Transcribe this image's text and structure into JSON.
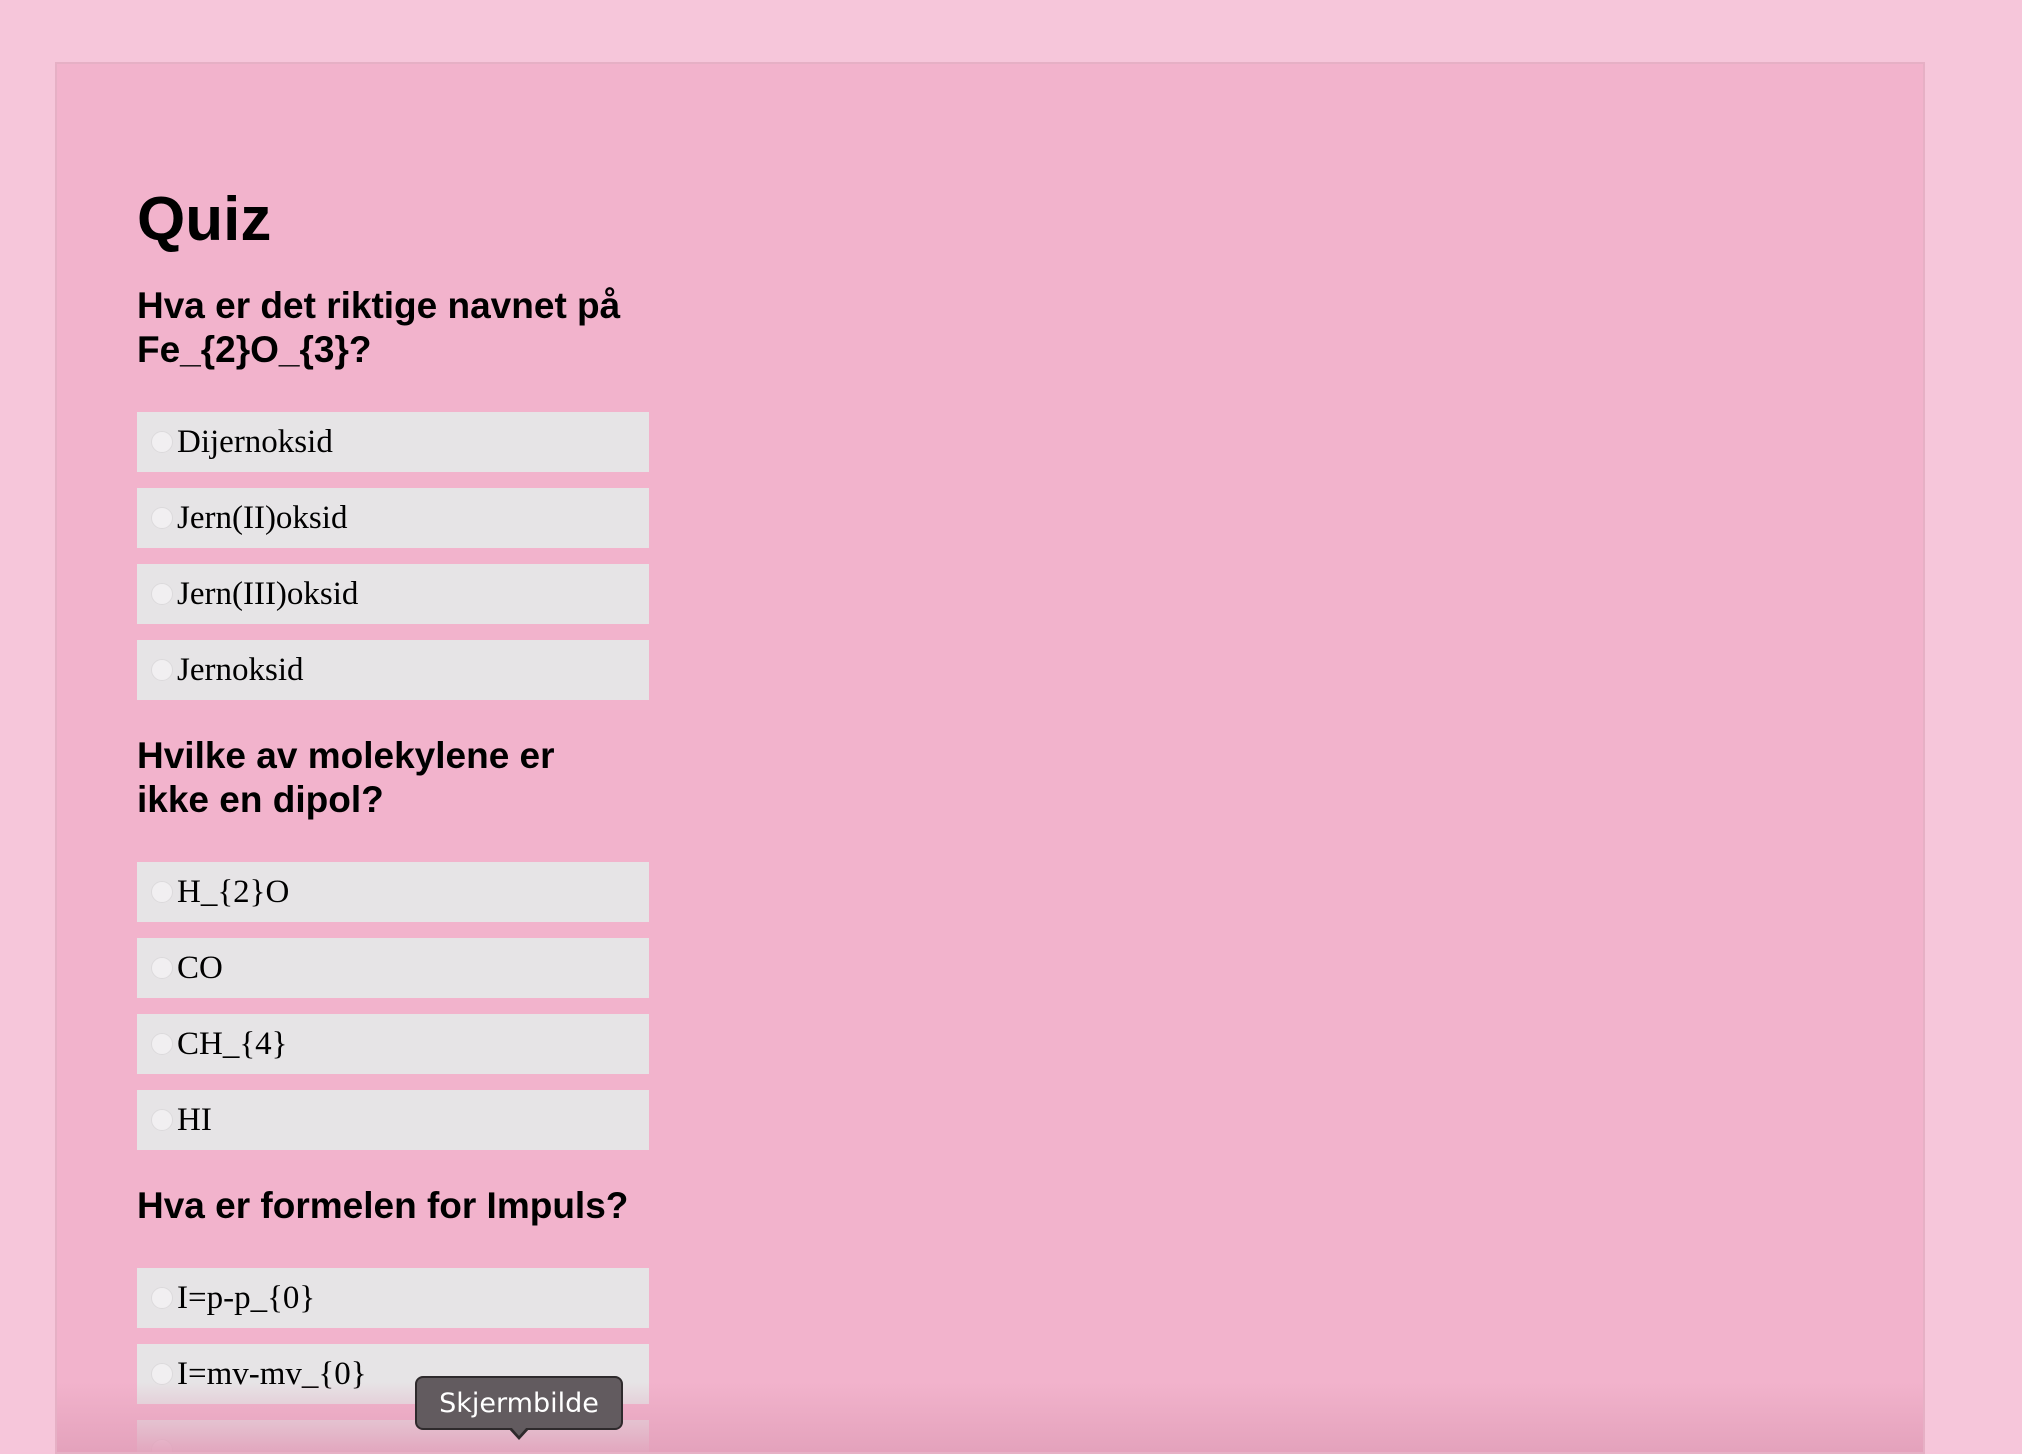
{
  "page": {
    "title": "Quiz"
  },
  "questions": [
    {
      "text": "Hva er det riktige navnet på Fe_{2}O_{3}?",
      "options": [
        "Dijernoksid",
        "Jern(II)oksid",
        "Jern(III)oksid",
        "Jernoksid"
      ]
    },
    {
      "text": "Hvilke av molekylene er ikke en dipol?",
      "options": [
        "H_{2}O",
        "CO",
        "CH_{4}",
        "HI"
      ]
    },
    {
      "text": "Hva er formelen for Impuls?",
      "options": [
        "I=p-p_{0}",
        "I=mv-mv_{0}",
        ""
      ]
    }
  ],
  "tooltip": {
    "text": "Skjermbilde"
  },
  "colors": {
    "page_background": "#f6c6da",
    "panel_background": "#f2b3cc",
    "option_background": "#e6e4e6",
    "tooltip_background": "#625b5f"
  }
}
